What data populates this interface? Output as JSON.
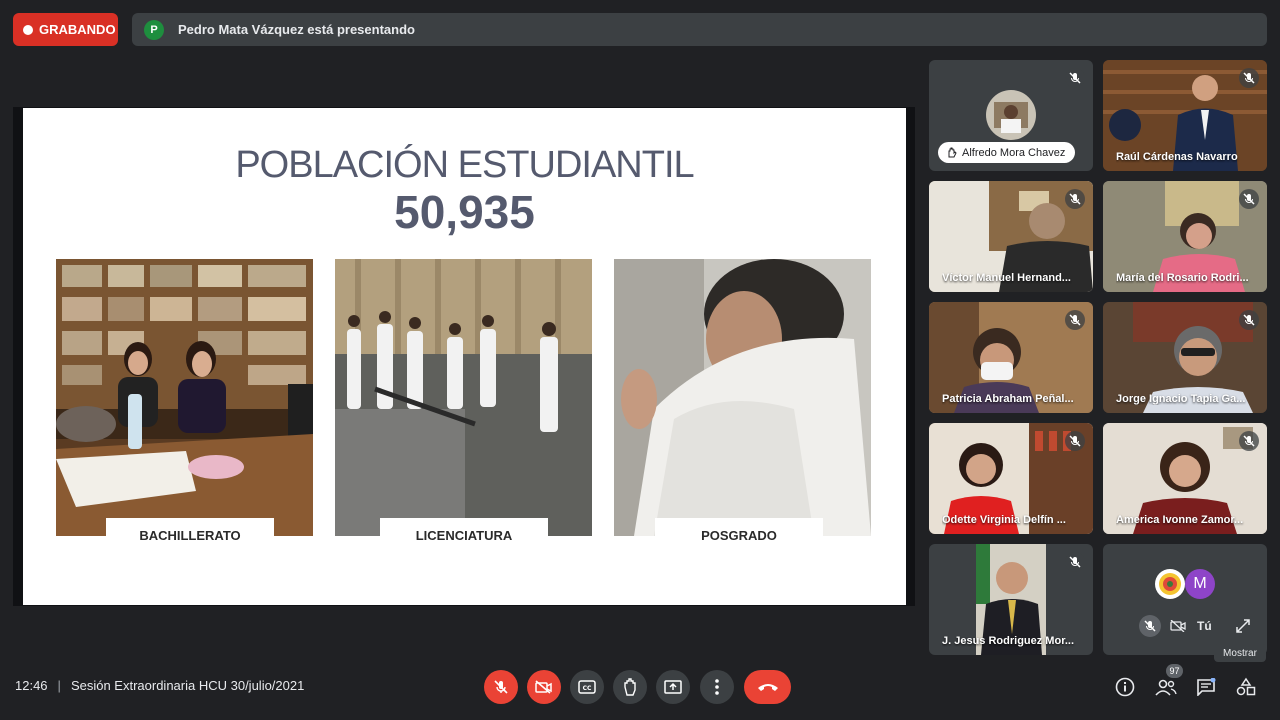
{
  "recording": {
    "label": "GRABANDO"
  },
  "presenter_bar": {
    "avatar_letter": "P",
    "text": "Pedro Mata Vázquez está presentando"
  },
  "slide": {
    "title": "POBLACIÓN ESTUDIANTIL",
    "number": "50,935",
    "photos": [
      {
        "caption": "BACHILLERATO"
      },
      {
        "caption": "LICENCIATURA"
      },
      {
        "caption": "POSGRADO"
      }
    ]
  },
  "participants": [
    {
      "name": "Alfredo Mora Chavez"
    },
    {
      "name": "Raúl Cárdenas Navarro"
    },
    {
      "name": "Víctor Manuel Hernand..."
    },
    {
      "name": "María del Rosario Rodri..."
    },
    {
      "name": "Patricia Abraham Peñal..."
    },
    {
      "name": "Jorge Ignacio Tapia Ga..."
    },
    {
      "name": "Odette Virginia Delfín ..."
    },
    {
      "name": "America Ivonne Zamor..."
    },
    {
      "name": "J. Jesus Rodriguez Mor..."
    }
  ],
  "self_tile": {
    "avatar_letter": "M",
    "label": "Tú",
    "tooltip": "Mostrar"
  },
  "footer": {
    "time": "12:46",
    "separator": "|",
    "meeting_name": "Sesión Extraordinaria HCU 30/julio/2021",
    "participant_count": "97"
  },
  "colors": {
    "record_red": "#d93025",
    "control_red": "#ea4335",
    "bg": "#202124",
    "tile": "#3c4043"
  }
}
